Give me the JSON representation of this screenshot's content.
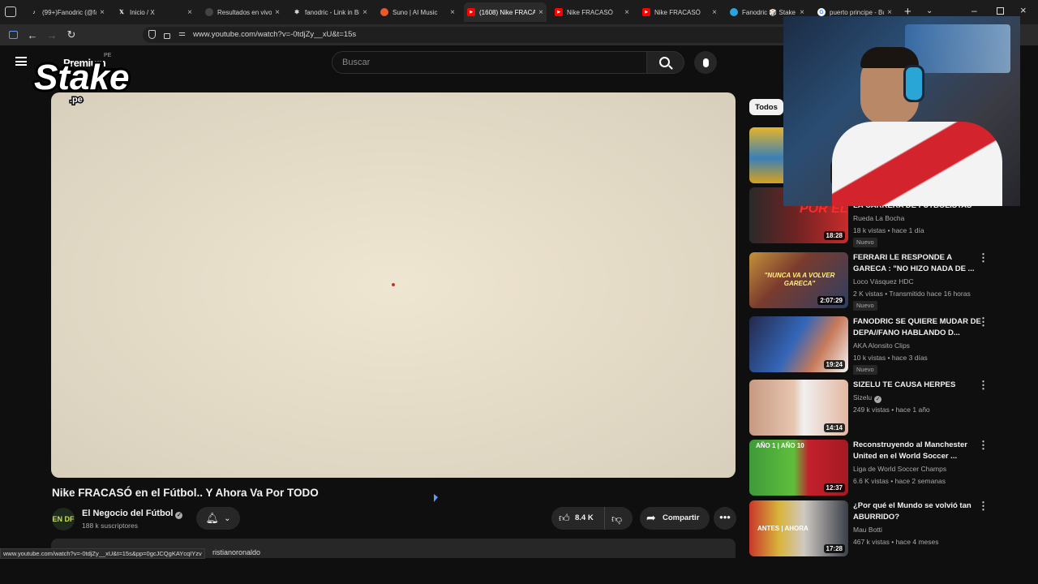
{
  "browser": {
    "tabs": [
      {
        "label": "(99+)Fanodric (@fa",
        "icon": "tiktok-icon",
        "active": false
      },
      {
        "label": "Inicio / X",
        "icon": "x-icon",
        "active": false
      },
      {
        "label": "Resultados en vivo",
        "icon": "site-icon",
        "active": false
      },
      {
        "label": "fanodric - Link in Bi",
        "icon": "link-icon",
        "active": false
      },
      {
        "label": "Suno | AI Music",
        "icon": "suno-icon",
        "active": false
      },
      {
        "label": "(1608) Nike FRACAS",
        "icon": "youtube-icon",
        "active": true
      },
      {
        "label": "Nike FRACASÓ",
        "icon": "youtube-icon",
        "active": false
      },
      {
        "label": "Nike FRACASÓ",
        "icon": "youtube-icon",
        "active": false
      },
      {
        "label": "Fanodric 🎲 Stake",
        "icon": "telegram-icon",
        "active": false
      },
      {
        "label": "puerto principe - Bu",
        "icon": "google-icon",
        "active": false
      }
    ],
    "url": "www.youtube.com/watch?v=-0tdjZy__xU&t=15s",
    "status_url": "www.youtube.com/watch?v=-0tdjZy__xU&t=15s&pp=0gcJCQgKAYcqIYzv"
  },
  "youtube": {
    "logo_text": "Premium",
    "region": "PE",
    "search_placeholder": "Buscar",
    "video": {
      "title": "Nike FRACASÓ en el Fútbol.. Y Ahora Va Por TODO",
      "channel": "El Negocio del Fútbol",
      "channel_avatar": "EN DF",
      "subscribers": "188 k suscriptores",
      "likes": "8.4 K",
      "share_label": "Compartir",
      "description_tag": "ristianoronaldo"
    },
    "chip_all": "Todos",
    "recommendations": [
      {
        "title": "LA CARRERA DE FUTBOLISTAS",
        "channel": "Rueda La Bocha",
        "meta": "18 k vistas • hace 1 día",
        "duration": "18:28",
        "badge": "Nuevo",
        "thumb_text": "POR EL"
      },
      {
        "title": "FERRARI LE RESPONDE A GARECA : \"NO HIZO NADA DE ...",
        "channel": "Loco Vásquez HDC",
        "meta": "2 K vistas • Transmitido hace 16 horas",
        "duration": "2:07:29",
        "badge": "Nuevo",
        "thumb_text": "\"NUNCA VA A VOLVER GARECA\""
      },
      {
        "title": "FANODRIC SE QUIERE MUDAR DE DEPA//FANO HABLANDO D...",
        "channel": "AKA Alonsito Clips",
        "meta": "10 k vistas • hace 3 días",
        "duration": "19:24",
        "badge": "Nuevo",
        "thumb_text": ""
      },
      {
        "title": "SIZELU TE CAUSA HERPES",
        "channel": "Sizelu",
        "meta": "249 k vistas • hace 1 año",
        "duration": "14:14",
        "badge": "",
        "thumb_text": ""
      },
      {
        "title": "Reconstruyendo al Manchester United en el World Soccer ...",
        "channel": "Liga de World Soccer Champs",
        "meta": "6.6 K vistas • hace 2 semanas",
        "duration": "12:37",
        "badge": "",
        "thumb_text": "AÑO 1 | AÑO 10"
      },
      {
        "title": "¿Por qué el Mundo se volvió tan ABURRIDO?",
        "channel": "Mau Botti",
        "meta": "467 k vistas • hace 4 meses",
        "duration": "17:28",
        "badge": "",
        "thumb_text": "ANTES | AHORA"
      }
    ]
  },
  "overlay": {
    "stake_text": "Stake",
    "stake_domain": ".pe"
  }
}
